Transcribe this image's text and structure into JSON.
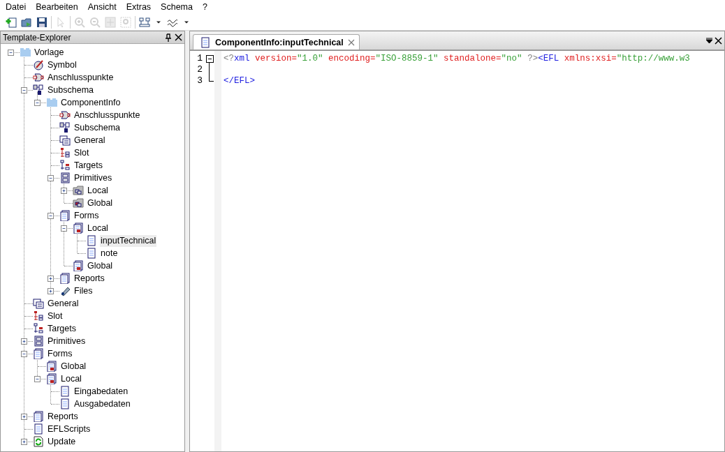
{
  "menu": [
    "Datei",
    "Bearbeiten",
    "Ansicht",
    "Extras",
    "Schema",
    "?"
  ],
  "toolbar": [
    [
      {
        "kind": "new",
        "disabled": false
      },
      {
        "kind": "open",
        "disabled": false
      },
      {
        "kind": "save",
        "disabled": false
      }
    ],
    [
      {
        "kind": "pointer",
        "disabled": true
      }
    ],
    [
      {
        "kind": "zoom-in",
        "disabled": true
      },
      {
        "kind": "zoom-out",
        "disabled": true
      },
      {
        "kind": "fit",
        "disabled": true
      },
      {
        "kind": "zoom-area",
        "disabled": true
      }
    ],
    [
      {
        "kind": "layout",
        "disabled": false
      },
      {
        "kind": "caret",
        "disabled": false
      },
      {
        "kind": "wave",
        "disabled": false
      },
      {
        "kind": "caret",
        "disabled": false
      }
    ]
  ],
  "explorer": {
    "title": "Template-Explorer",
    "tree": [
      {
        "label": "Vorlage",
        "kind": "folder",
        "expanded": true,
        "selected": false,
        "children": [
          {
            "label": "Symbol",
            "kind": "symbol",
            "selected": false
          },
          {
            "label": "Anschlusspunkte",
            "kind": "connector",
            "selected": false
          },
          {
            "label": "Subschema",
            "kind": "subschema",
            "expanded": true,
            "selected": false,
            "children": [
              {
                "label": "ComponentInfo",
                "kind": "folder",
                "expanded": true,
                "selected": false,
                "children": [
                  {
                    "label": "Anschlusspunkte",
                    "kind": "connector",
                    "selected": false
                  },
                  {
                    "label": "Subschema",
                    "kind": "subschema",
                    "selected": false
                  },
                  {
                    "label": "General",
                    "kind": "general",
                    "selected": false
                  },
                  {
                    "label": "Slot",
                    "kind": "slot",
                    "selected": false
                  },
                  {
                    "label": "Targets",
                    "kind": "targets",
                    "selected": false
                  },
                  {
                    "label": "Primitives",
                    "kind": "primitives",
                    "expanded": true,
                    "selected": false,
                    "children": [
                      {
                        "label": "Local",
                        "kind": "box-folder",
                        "expanded": false,
                        "selected": false
                      },
                      {
                        "label": "Global",
                        "kind": "box-folder-red",
                        "selected": false
                      }
                    ]
                  },
                  {
                    "label": "Forms",
                    "kind": "forms",
                    "expanded": true,
                    "selected": false,
                    "children": [
                      {
                        "label": "Local",
                        "kind": "form-folder",
                        "expanded": true,
                        "selected": false,
                        "children": [
                          {
                            "label": "inputTechnical",
                            "kind": "form",
                            "selected": true
                          },
                          {
                            "label": "note",
                            "kind": "form",
                            "selected": false
                          }
                        ]
                      },
                      {
                        "label": "Global",
                        "kind": "form-folder",
                        "selected": false
                      }
                    ]
                  },
                  {
                    "label": "Reports",
                    "kind": "reports",
                    "expanded": false,
                    "selected": false
                  },
                  {
                    "label": "Files",
                    "kind": "files",
                    "expanded": false,
                    "selected": false
                  }
                ]
              }
            ]
          },
          {
            "label": "General",
            "kind": "general",
            "selected": false
          },
          {
            "label": "Slot",
            "kind": "slot",
            "selected": false
          },
          {
            "label": "Targets",
            "kind": "targets",
            "selected": false
          },
          {
            "label": "Primitives",
            "kind": "primitives",
            "expanded": false,
            "selected": false
          },
          {
            "label": "Forms",
            "kind": "forms",
            "expanded": true,
            "selected": false,
            "children": [
              {
                "label": "Global",
                "kind": "form-folder",
                "selected": false
              },
              {
                "label": "Local",
                "kind": "form-folder",
                "expanded": true,
                "selected": false,
                "children": [
                  {
                    "label": "Eingabedaten",
                    "kind": "form",
                    "selected": false
                  },
                  {
                    "label": "Ausgabedaten",
                    "kind": "form",
                    "selected": false
                  }
                ]
              }
            ]
          },
          {
            "label": "Reports",
            "kind": "reports",
            "expanded": false,
            "selected": false
          },
          {
            "label": "EFLScripts",
            "kind": "form",
            "selected": false
          },
          {
            "label": "Update",
            "kind": "update",
            "expanded": false,
            "selected": false
          }
        ]
      }
    ]
  },
  "editor": {
    "tabs": [
      {
        "label": "ComponentInfo:inputTechnical",
        "selected": true
      }
    ],
    "lines": [
      {
        "number": "1",
        "kind": "fold-start",
        "tokens": [
          {
            "kind": "punct",
            "text": "<?"
          },
          {
            "kind": "tag",
            "text": "xml"
          },
          {
            "kind": "attr",
            "text": " version="
          },
          {
            "kind": "value",
            "text": "\"1.0\""
          },
          {
            "kind": "attr",
            "text": " encoding="
          },
          {
            "kind": "value",
            "text": "\"ISO-8859-1\""
          },
          {
            "kind": "attr",
            "text": " standalone="
          },
          {
            "kind": "value",
            "text": "\"no\""
          },
          {
            "kind": "punct",
            "text": " ?>"
          },
          {
            "kind": "tag",
            "text": "<EFL"
          },
          {
            "kind": "attr",
            "text": " xmlns:xsi="
          },
          {
            "kind": "value",
            "text": "\"http://www.w3"
          }
        ]
      },
      {
        "number": "2",
        "kind": "fold-inside"
      },
      {
        "number": "3",
        "kind": "fold-end",
        "tokens": [
          {
            "kind": "tag",
            "text": "</EFL>"
          }
        ]
      }
    ]
  }
}
